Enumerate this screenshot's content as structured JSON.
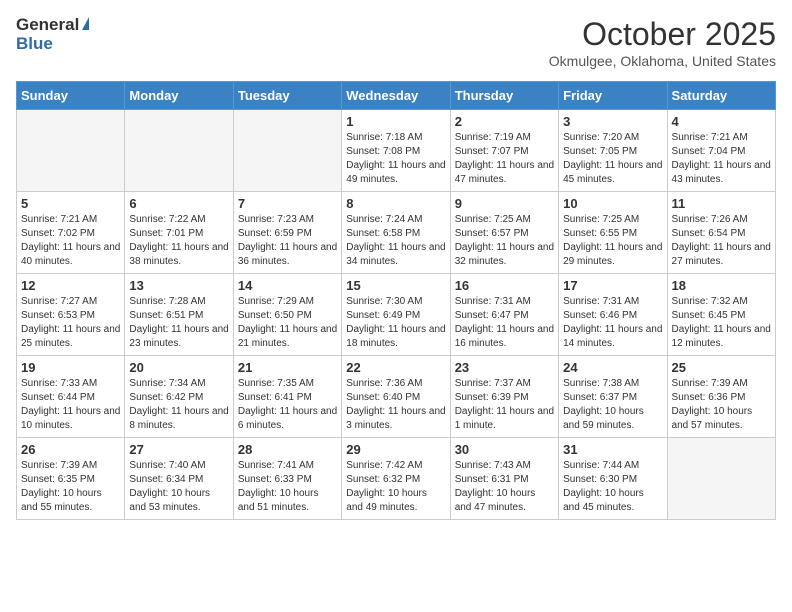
{
  "header": {
    "logo_general": "General",
    "logo_blue": "Blue",
    "month_title": "October 2025",
    "subtitle": "Okmulgee, Oklahoma, United States"
  },
  "weekdays": [
    "Sunday",
    "Monday",
    "Tuesday",
    "Wednesday",
    "Thursday",
    "Friday",
    "Saturday"
  ],
  "weeks": [
    [
      {
        "day": "",
        "info": ""
      },
      {
        "day": "",
        "info": ""
      },
      {
        "day": "",
        "info": ""
      },
      {
        "day": "1",
        "info": "Sunrise: 7:18 AM\nSunset: 7:08 PM\nDaylight: 11 hours and 49 minutes."
      },
      {
        "day": "2",
        "info": "Sunrise: 7:19 AM\nSunset: 7:07 PM\nDaylight: 11 hours and 47 minutes."
      },
      {
        "day": "3",
        "info": "Sunrise: 7:20 AM\nSunset: 7:05 PM\nDaylight: 11 hours and 45 minutes."
      },
      {
        "day": "4",
        "info": "Sunrise: 7:21 AM\nSunset: 7:04 PM\nDaylight: 11 hours and 43 minutes."
      }
    ],
    [
      {
        "day": "5",
        "info": "Sunrise: 7:21 AM\nSunset: 7:02 PM\nDaylight: 11 hours and 40 minutes."
      },
      {
        "day": "6",
        "info": "Sunrise: 7:22 AM\nSunset: 7:01 PM\nDaylight: 11 hours and 38 minutes."
      },
      {
        "day": "7",
        "info": "Sunrise: 7:23 AM\nSunset: 6:59 PM\nDaylight: 11 hours and 36 minutes."
      },
      {
        "day": "8",
        "info": "Sunrise: 7:24 AM\nSunset: 6:58 PM\nDaylight: 11 hours and 34 minutes."
      },
      {
        "day": "9",
        "info": "Sunrise: 7:25 AM\nSunset: 6:57 PM\nDaylight: 11 hours and 32 minutes."
      },
      {
        "day": "10",
        "info": "Sunrise: 7:25 AM\nSunset: 6:55 PM\nDaylight: 11 hours and 29 minutes."
      },
      {
        "day": "11",
        "info": "Sunrise: 7:26 AM\nSunset: 6:54 PM\nDaylight: 11 hours and 27 minutes."
      }
    ],
    [
      {
        "day": "12",
        "info": "Sunrise: 7:27 AM\nSunset: 6:53 PM\nDaylight: 11 hours and 25 minutes."
      },
      {
        "day": "13",
        "info": "Sunrise: 7:28 AM\nSunset: 6:51 PM\nDaylight: 11 hours and 23 minutes."
      },
      {
        "day": "14",
        "info": "Sunrise: 7:29 AM\nSunset: 6:50 PM\nDaylight: 11 hours and 21 minutes."
      },
      {
        "day": "15",
        "info": "Sunrise: 7:30 AM\nSunset: 6:49 PM\nDaylight: 11 hours and 18 minutes."
      },
      {
        "day": "16",
        "info": "Sunrise: 7:31 AM\nSunset: 6:47 PM\nDaylight: 11 hours and 16 minutes."
      },
      {
        "day": "17",
        "info": "Sunrise: 7:31 AM\nSunset: 6:46 PM\nDaylight: 11 hours and 14 minutes."
      },
      {
        "day": "18",
        "info": "Sunrise: 7:32 AM\nSunset: 6:45 PM\nDaylight: 11 hours and 12 minutes."
      }
    ],
    [
      {
        "day": "19",
        "info": "Sunrise: 7:33 AM\nSunset: 6:44 PM\nDaylight: 11 hours and 10 minutes."
      },
      {
        "day": "20",
        "info": "Sunrise: 7:34 AM\nSunset: 6:42 PM\nDaylight: 11 hours and 8 minutes."
      },
      {
        "day": "21",
        "info": "Sunrise: 7:35 AM\nSunset: 6:41 PM\nDaylight: 11 hours and 6 minutes."
      },
      {
        "day": "22",
        "info": "Sunrise: 7:36 AM\nSunset: 6:40 PM\nDaylight: 11 hours and 3 minutes."
      },
      {
        "day": "23",
        "info": "Sunrise: 7:37 AM\nSunset: 6:39 PM\nDaylight: 11 hours and 1 minute."
      },
      {
        "day": "24",
        "info": "Sunrise: 7:38 AM\nSunset: 6:37 PM\nDaylight: 10 hours and 59 minutes."
      },
      {
        "day": "25",
        "info": "Sunrise: 7:39 AM\nSunset: 6:36 PM\nDaylight: 10 hours and 57 minutes."
      }
    ],
    [
      {
        "day": "26",
        "info": "Sunrise: 7:39 AM\nSunset: 6:35 PM\nDaylight: 10 hours and 55 minutes."
      },
      {
        "day": "27",
        "info": "Sunrise: 7:40 AM\nSunset: 6:34 PM\nDaylight: 10 hours and 53 minutes."
      },
      {
        "day": "28",
        "info": "Sunrise: 7:41 AM\nSunset: 6:33 PM\nDaylight: 10 hours and 51 minutes."
      },
      {
        "day": "29",
        "info": "Sunrise: 7:42 AM\nSunset: 6:32 PM\nDaylight: 10 hours and 49 minutes."
      },
      {
        "day": "30",
        "info": "Sunrise: 7:43 AM\nSunset: 6:31 PM\nDaylight: 10 hours and 47 minutes."
      },
      {
        "day": "31",
        "info": "Sunrise: 7:44 AM\nSunset: 6:30 PM\nDaylight: 10 hours and 45 minutes."
      },
      {
        "day": "",
        "info": ""
      }
    ]
  ]
}
